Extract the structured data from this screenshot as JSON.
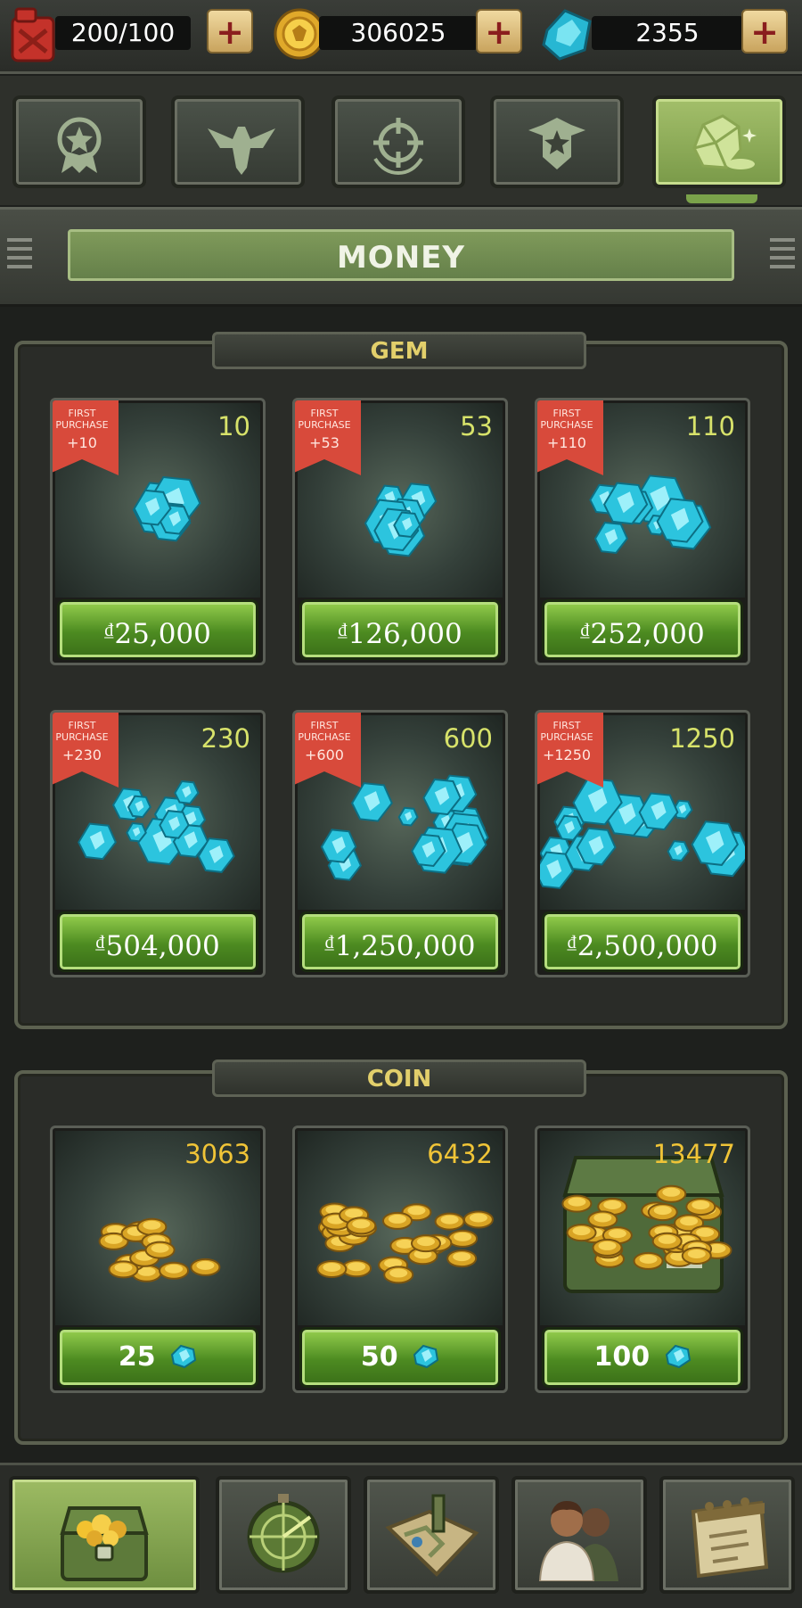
{
  "resources": {
    "fuel": {
      "value": "200/100",
      "icon": "fuel-can-icon"
    },
    "coins": {
      "value": "306025",
      "icon": "coin-icon"
    },
    "gems": {
      "value": "2355",
      "icon": "gem-icon"
    },
    "add_label": "+"
  },
  "tabs": [
    {
      "name": "medal",
      "icon": "medal-icon"
    },
    {
      "name": "eagle",
      "icon": "eagle-icon"
    },
    {
      "name": "target",
      "icon": "crosshair-icon"
    },
    {
      "name": "badge",
      "icon": "shield-star-icon"
    },
    {
      "name": "money",
      "icon": "gem-rock-icon",
      "active": true
    }
  ],
  "header": {
    "title": "MONEY"
  },
  "gem_section": {
    "title": "GEM",
    "ribbon_line1": "FIRST",
    "ribbon_line2": "PURCHASE",
    "items": [
      {
        "amount": "10",
        "bonus": "+10",
        "price": "25,000"
      },
      {
        "amount": "53",
        "bonus": "+53",
        "price": "126,000"
      },
      {
        "amount": "110",
        "bonus": "+110",
        "price": "252,000"
      },
      {
        "amount": "230",
        "bonus": "+230",
        "price": "504,000"
      },
      {
        "amount": "600",
        "bonus": "+600",
        "price": "1,250,000"
      },
      {
        "amount": "1250",
        "bonus": "+1250",
        "price": "2,500,000"
      }
    ],
    "currency_symbol": "₫"
  },
  "coin_section": {
    "title": "COIN",
    "items": [
      {
        "amount": "3063",
        "price": "25"
      },
      {
        "amount": "6432",
        "price": "50"
      },
      {
        "amount": "13477",
        "price": "100"
      }
    ]
  },
  "bottom_nav": [
    {
      "name": "shop",
      "icon": "treasure-chest-icon",
      "active": true
    },
    {
      "name": "radar",
      "icon": "radar-icon"
    },
    {
      "name": "map",
      "icon": "map-icon"
    },
    {
      "name": "squad",
      "icon": "soldiers-icon"
    },
    {
      "name": "missions",
      "icon": "clipboard-icon"
    }
  ],
  "colors": {
    "accent_green": "#4d8b21",
    "gem_cyan": "#27c6e0",
    "coin_gold": "#f0c437",
    "ribbon_red": "#d84a3b"
  }
}
